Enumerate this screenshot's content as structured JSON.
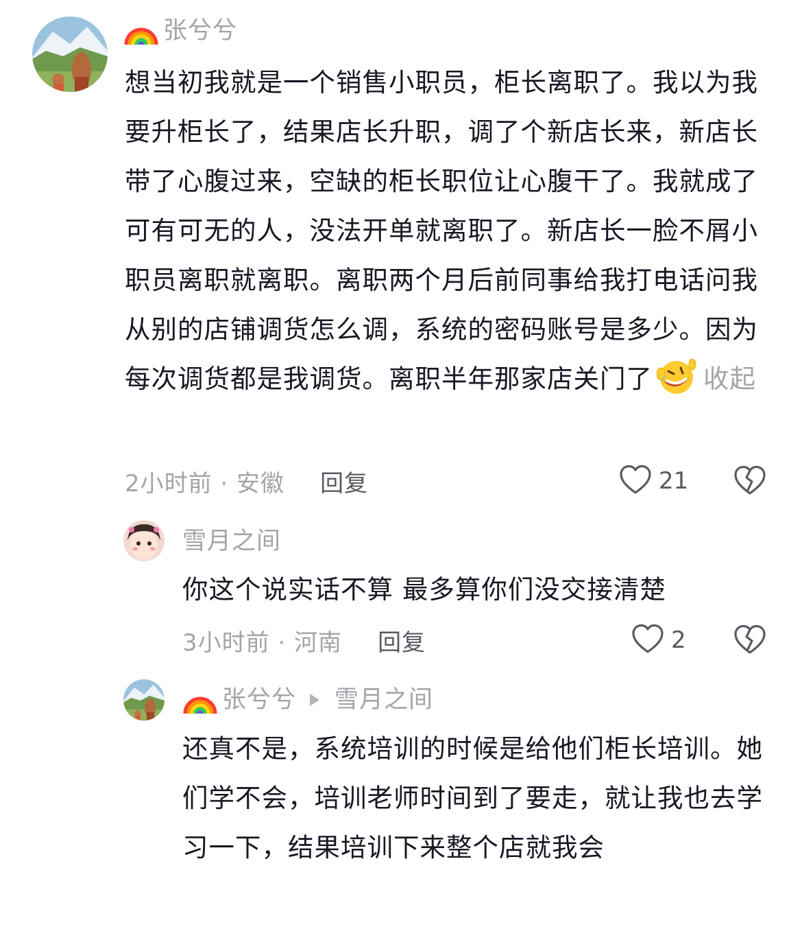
{
  "comments": [
    {
      "username": "张兮兮",
      "badge_icon": "rainbow-icon",
      "body": "想当初我就是一个销售小职员，柜长离职了。我以为我要升柜长了，结果店长升职，调了个新店长来，新店长带了心腹过来，空缺的柜长职位让心腹干了。我就成了可有可无的人，没法开单就离职了。新店长一脸不屑小职员离职就离职。离职两个月后前同事给我打电话问我从别的店铺调货怎么调，系统的密码账号是多少。因为每次调货都是我调货。离职半年那家店关门了",
      "emoji_icon": "rolling-on-floor-laughing-emoji",
      "collapse_label": "收起",
      "time_location": "2小时前 · 安徽",
      "reply_label": "回复",
      "like_count": "21"
    },
    {
      "username": "雪月之间",
      "body": "你这个说实话不算 最多算你们没交接清楚",
      "time_location": "3小时前 · 河南",
      "reply_label": "回复",
      "like_count": "2"
    },
    {
      "username": "张兮兮",
      "badge_icon": "rainbow-icon",
      "reply_to": "雪月之间",
      "body": "还真不是，系统培训的时候是给他们柜长培训。她们学不会，培训老师时间到了要走，就让我也去学习一下，结果培训下来整个店就我会"
    }
  ],
  "colors": {
    "primary_text": "#161823",
    "secondary_text": "#a3a4aa",
    "action_text": "#585a62",
    "background": "#ffffff"
  }
}
